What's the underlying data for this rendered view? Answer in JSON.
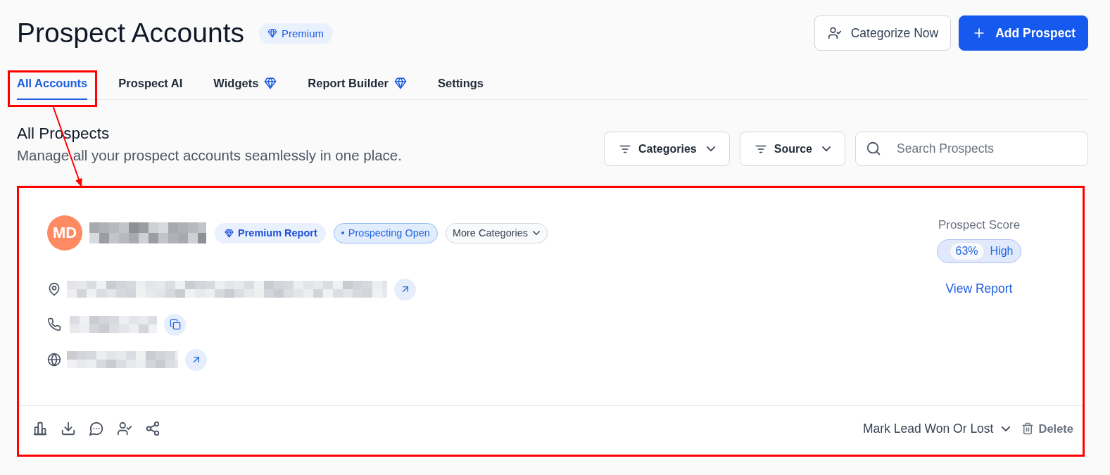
{
  "header": {
    "title": "Prospect Accounts",
    "badge": "Premium",
    "buttons": [
      {
        "kind": "secondary",
        "label": "Categorize Now"
      },
      {
        "kind": "primary",
        "label": "Add Prospect"
      }
    ]
  },
  "tabs": [
    {
      "label": "All Accounts",
      "selected": true,
      "premium": false
    },
    {
      "label": "Prospect AI",
      "selected": false,
      "premium": false
    },
    {
      "label": "Widgets",
      "selected": false,
      "premium": true
    },
    {
      "label": "Report Builder",
      "selected": false,
      "premium": true
    },
    {
      "label": "Settings",
      "selected": false,
      "premium": false
    }
  ],
  "section": {
    "title": "All Prospects",
    "subtitle": "Manage all your prospect accounts seamlessly in one place."
  },
  "filters": [
    {
      "label": "Categories"
    },
    {
      "label": "Source"
    }
  ],
  "search": {
    "placeholder": "Search Prospects"
  },
  "card": {
    "avatar": "MD",
    "tags": [
      {
        "kind": "premium",
        "label": "Premium Report"
      },
      {
        "kind": "status",
        "label": "Prospecting Open"
      },
      {
        "kind": "dropdown",
        "label": "More Categories"
      }
    ],
    "contacts": [
      {
        "kind": "address"
      },
      {
        "kind": "phone"
      },
      {
        "kind": "website"
      }
    ],
    "score": {
      "label": "Prospect Score",
      "value": "63%",
      "rating": "High"
    },
    "link": "View Report",
    "footer_actions": [
      {
        "kind": "chart"
      },
      {
        "kind": "download"
      },
      {
        "kind": "comment"
      },
      {
        "kind": "assign"
      },
      {
        "kind": "share"
      }
    ],
    "status_menu": "Mark Lead Won Or Lost",
    "delete": "Delete"
  },
  "annotations": [
    {
      "kind": "tab-frame"
    },
    {
      "kind": "arrow"
    },
    {
      "kind": "card-frame"
    }
  ]
}
